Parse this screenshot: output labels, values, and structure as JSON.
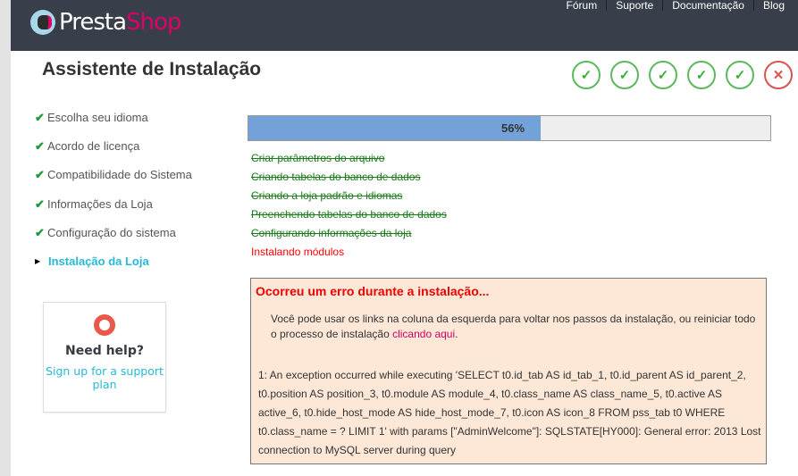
{
  "header": {
    "logo_left": "Presta",
    "logo_right": "Shop",
    "nav": [
      "Fórum",
      "Suporte",
      "Documentação",
      "Blog"
    ]
  },
  "title": "Assistente de Instalação",
  "step_status": [
    "done",
    "done",
    "done",
    "done",
    "done",
    "error"
  ],
  "sidebar": {
    "steps": [
      {
        "label": "Escolha seu idioma",
        "state": "done"
      },
      {
        "label": "Acordo de licença",
        "state": "done"
      },
      {
        "label": "Compatibilidade do Sistema",
        "state": "done"
      },
      {
        "label": "Informações da Loja",
        "state": "done"
      },
      {
        "label": "Configuração do sistema",
        "state": "done"
      },
      {
        "label": "Instalação da Loja",
        "state": "current"
      }
    ]
  },
  "help": {
    "question": "Need help?",
    "link": "Sign up for a support plan"
  },
  "progress": {
    "percent": 56,
    "label": "56%"
  },
  "tasks": [
    {
      "label": "Criar parâmetros do arquivo",
      "done": true
    },
    {
      "label": "Criando tabelas do banco de dados",
      "done": true
    },
    {
      "label": "Criando a loja padrão e idiomas",
      "done": true
    },
    {
      "label": "Preenchendo tabelas do banco de dados",
      "done": true
    },
    {
      "label": "Configurando informações da loja",
      "done": true
    },
    {
      "label": "Instalando módulos",
      "done": false
    }
  ],
  "error": {
    "title": "Ocorreu um erro durante a instalação...",
    "message": "Você pode usar os links na coluna da esquerda para voltar nos passos da instalação, ou reiniciar todo o processo de instalação ",
    "link": "clicando aqui",
    "message_end": ".",
    "detail": "1: An exception occurred while executing 'SELECT t0.id_tab AS id_tab_1, t0.id_parent AS id_parent_2, t0.position AS position_3, t0.module AS module_4, t0.class_name AS class_name_5, t0.active AS active_6, t0.hide_host_mode AS hide_host_mode_7, t0.icon AS icon_8 FROM pss_tab t0 WHERE t0.class_name = ? LIMIT 1' with params [\"AdminWelcome\"]: SQLSTATE[HY000]: General error: 2013 Lost connection to MySQL server during query"
  }
}
